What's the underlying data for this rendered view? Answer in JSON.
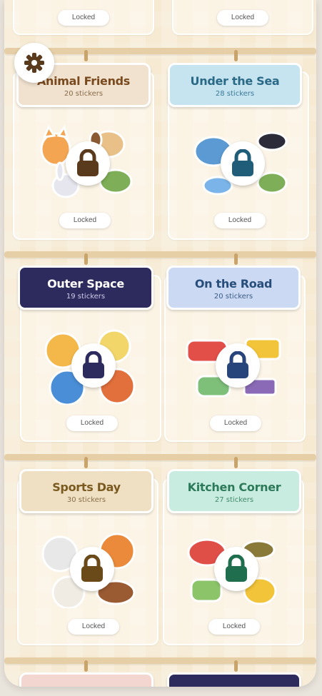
{
  "locked_label": "Locked",
  "top_row": {
    "left_label": "Locked",
    "right_label": "Locked"
  },
  "settings": {
    "icon": "gear-icon"
  },
  "albums": [
    {
      "title": "Animal Friends",
      "count": "20 stickers",
      "status": "Locked",
      "header_color": "#f1e2cf",
      "title_color": "#7a4a1f",
      "sub_color": "#8a6a4a",
      "lock_color": "#5a3a1c"
    },
    {
      "title": "Under the Sea",
      "count": "28 stickers",
      "status": "Locked",
      "header_color": "#c6e3f0",
      "title_color": "#2a6a86",
      "sub_color": "#3a7a96",
      "lock_color": "#1f5d78"
    },
    {
      "title": "Outer Space",
      "count": "19 stickers",
      "status": "Locked",
      "header_color": "#2d2a5e",
      "title_color": "#ffffff",
      "sub_color": "#d0cde8",
      "lock_color": "#2d2a5e"
    },
    {
      "title": "On the Road",
      "count": "20 stickers",
      "status": "Locked",
      "header_color": "#cbd9f2",
      "title_color": "#274e7a",
      "sub_color": "#3c5d86",
      "lock_color": "#27457a"
    },
    {
      "title": "Sports Day",
      "count": "30 stickers",
      "status": "Locked",
      "header_color": "#efe0c4",
      "title_color": "#7a5a1f",
      "sub_color": "#8a6e4a",
      "lock_color": "#6b4a1a"
    },
    {
      "title": "Kitchen Corner",
      "count": "27 stickers",
      "status": "Locked",
      "header_color": "#c9ece0",
      "title_color": "#2c7a5a",
      "sub_color": "#3f8a6a",
      "lock_color": "#1f6e4e"
    }
  ]
}
